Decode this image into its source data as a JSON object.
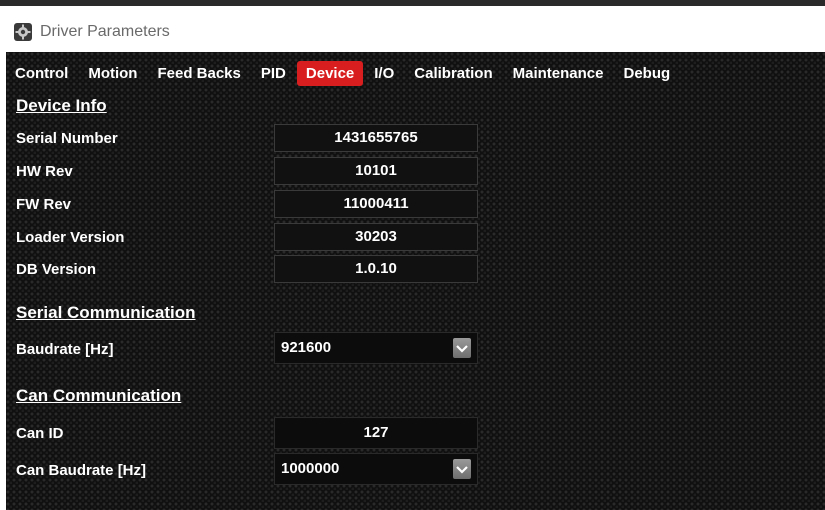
{
  "window": {
    "title": "Driver Parameters",
    "icon": "app-gear-icon"
  },
  "tabs": [
    {
      "label": "Control",
      "active": false
    },
    {
      "label": "Motion",
      "active": false
    },
    {
      "label": "Feed Backs",
      "active": false
    },
    {
      "label": "PID",
      "active": false
    },
    {
      "label": "Device",
      "active": true
    },
    {
      "label": "I/O",
      "active": false
    },
    {
      "label": "Calibration",
      "active": false
    },
    {
      "label": "Maintenance",
      "active": false
    },
    {
      "label": "Debug",
      "active": false
    }
  ],
  "device_info": {
    "title": "Device Info",
    "rows": [
      {
        "label": "Serial Number",
        "value": "1431655765"
      },
      {
        "label": "HW Rev",
        "value": "10101"
      },
      {
        "label": "FW Rev",
        "value": "11000411"
      },
      {
        "label": "Loader Version",
        "value": "30203"
      },
      {
        "label": "DB Version",
        "value": "1.0.10"
      }
    ]
  },
  "serial_comm": {
    "title": "Serial Communication",
    "baudrate_label": "Baudrate [Hz]",
    "baudrate_value": "921600"
  },
  "can_comm": {
    "title": "Can Communication",
    "can_id_label": "Can ID",
    "can_id_value": "127",
    "baudrate_label": "Can Baudrate [Hz]",
    "baudrate_value": "1000000"
  },
  "colors": {
    "accent": "#d81e1e",
    "background": "#101010",
    "text": "#ffffff"
  }
}
